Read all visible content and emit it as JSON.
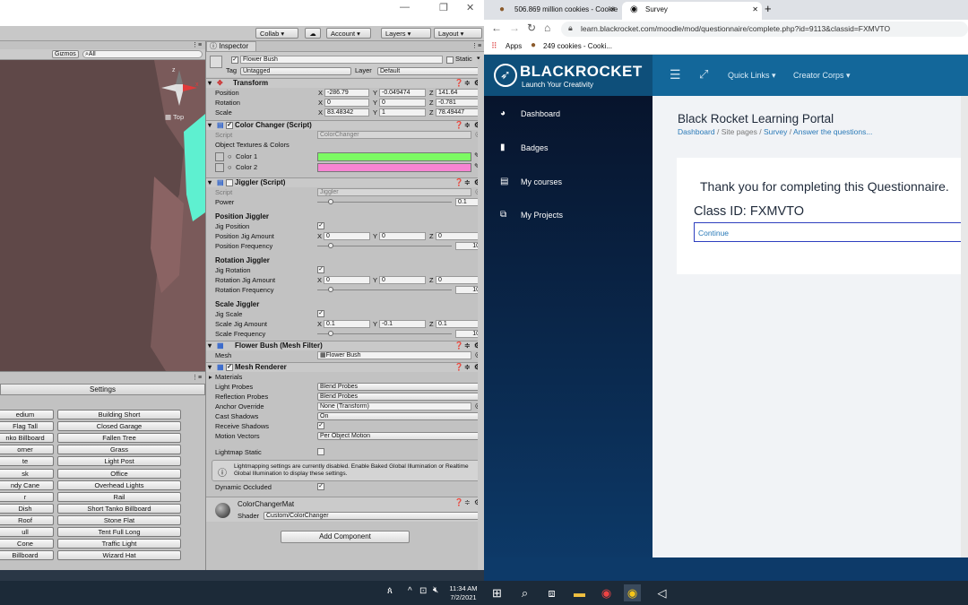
{
  "unity": {
    "toolbar": {
      "collab": "Collab ▾",
      "account": "Account ▾",
      "layers": "Layers ▾",
      "layout": "Layout ▾"
    },
    "scene": {
      "gizmos": "Gizmos ▾",
      "search_placeholder": "All",
      "view_label": "Top"
    },
    "inspector": {
      "tab": "Inspector",
      "object_name": "Flower Bush",
      "static_label": "Static",
      "tag_label": "Tag",
      "tag_value": "Untagged",
      "layer_label": "Layer",
      "layer_value": "Default",
      "transform": {
        "title": "Transform",
        "position_label": "Position",
        "position": {
          "x": "-286.79",
          "y": "-0.049474",
          "z": "141.64"
        },
        "rotation_label": "Rotation",
        "rotation": {
          "x": "0",
          "y": "0",
          "z": "-0.781"
        },
        "scale_label": "Scale",
        "scale": {
          "x": "83.48342",
          "y": "1",
          "z": "78.49447"
        }
      },
      "color_changer": {
        "title": "Color Changer (Script)",
        "script_label": "Script",
        "script_value": "ColorChanger",
        "textures_label": "Object Textures & Colors",
        "color1_label": "Color 1",
        "color1": "#7cfa63",
        "color2_label": "Color 2",
        "color2": "#f784d3"
      },
      "jiggler": {
        "title": "Jiggler (Script)",
        "script_label": "Script",
        "script_value": "Jiggler",
        "power_label": "Power",
        "power": "0.1",
        "position_section": "Position Jiggler",
        "jig_position_label": "Jig Position",
        "position_amount_label": "Position Jig Amount",
        "position_amount": {
          "x": "0",
          "y": "0",
          "z": "0"
        },
        "position_frequency_label": "Position Frequency",
        "position_frequency": "10",
        "rotation_section": "Rotation Jiggler",
        "jig_rotation_label": "Jig Rotation",
        "rotation_amount_label": "Rotation Jig Amount",
        "rotation_amount": {
          "x": "0",
          "y": "0",
          "z": "0"
        },
        "rotation_frequency_label": "Rotation Frequency",
        "rotation_frequency": "10",
        "scale_section": "Scale Jiggler",
        "jig_scale_label": "Jig Scale",
        "scale_amount_label": "Scale Jig Amount",
        "scale_amount": {
          "x": "0.1",
          "y": "-0.1",
          "z": "0.1"
        },
        "scale_frequency_label": "Scale Frequency",
        "scale_frequency": "10"
      },
      "mesh_filter": {
        "title": "Flower Bush (Mesh Filter)",
        "mesh_label": "Mesh",
        "mesh_value": "Flower Bush"
      },
      "mesh_renderer": {
        "title": "Mesh Renderer",
        "materials_label": "Materials",
        "light_probes_label": "Light Probes",
        "light_probes": "Blend Probes",
        "reflection_probes_label": "Reflection Probes",
        "reflection_probes": "Blend Probes",
        "anchor_label": "Anchor Override",
        "anchor": "None (Transform)",
        "cast_shadows_label": "Cast Shadows",
        "cast_shadows": "On",
        "receive_shadows_label": "Receive Shadows",
        "motion_vectors_label": "Motion Vectors",
        "motion_vectors": "Per Object Motion",
        "lightmap_static_label": "Lightmap Static",
        "info": "Lightmapping settings are currently disabled. Enable Baked Global Illumination or Realtime Global Illumination to display these settings.",
        "dynamic_occluded_label": "Dynamic Occluded"
      },
      "material": {
        "name": "ColorChangerMat",
        "shader_label": "Shader",
        "shader": "Custom/ColorChanger"
      },
      "add_component": "Add Component"
    },
    "settings_label": "Settings",
    "buttons_left": [
      "edium",
      "Flag Tall",
      "nko Billboard",
      "orner",
      "te",
      "sk",
      "ndy Cane",
      "r",
      "Dish",
      "Roof",
      "ull",
      "Cone",
      "Billboard"
    ],
    "buttons_right": [
      "Building Short",
      "Closed Garage",
      "Fallen Tree",
      "Grass",
      "Light Post",
      "Office",
      "Overhead Lights",
      "Rail",
      "Short Tanko Billboard",
      "Stone Flat",
      "Tent Full Long",
      "Traffic Light",
      "Wizard Hat"
    ]
  },
  "browser": {
    "tab1": "506.869 million cookies - Cookie",
    "tab2": "Survey",
    "url": "learn.blackrocket.com/moodle/mod/questionnaire/complete.php?id=9113&classid=FXMVTO",
    "bookmarks": {
      "apps": "Apps",
      "cookies": "249 cookies - Cooki..."
    },
    "site": {
      "logo_main": "BLACKROCKET",
      "logo_tag": "Launch Your Creativity",
      "nav_quick": "Quick Links ▾",
      "nav_creator": "Creator Corps ▾",
      "sidebar": [
        "Dashboard",
        "Badges",
        "My courses",
        "My Projects"
      ],
      "portal_title": "Black Rocket Learning Portal",
      "breadcrumb": {
        "dashboard": "Dashboard",
        "sep": " / ",
        "site_pages": "Site pages",
        "survey": "Survey",
        "answer": "Answer the questions..."
      },
      "thank_you": "Thank you for completing this Questionnaire.",
      "class_id": "Class ID: FXMVTO",
      "continue": "Continue"
    }
  },
  "taskbar": {
    "time": "11:34 AM",
    "date": "7/2/2021"
  }
}
